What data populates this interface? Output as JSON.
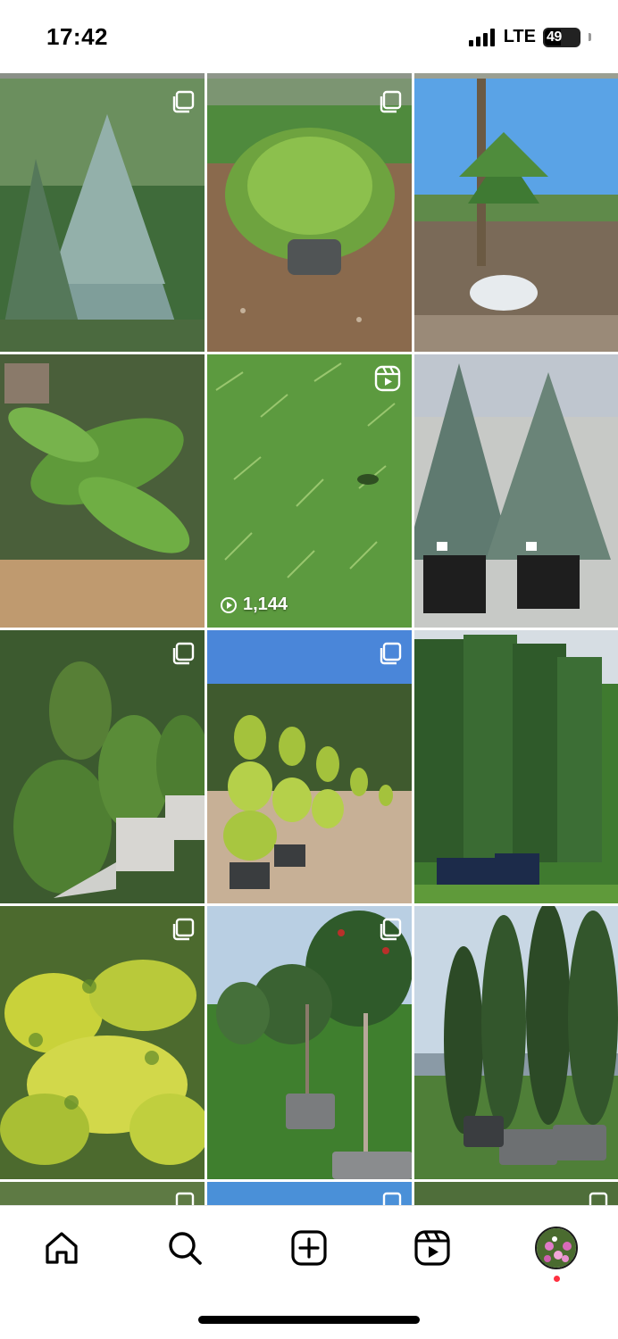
{
  "status_bar": {
    "time": "17:42",
    "network": "LTE",
    "battery": "49"
  },
  "grid": {
    "posts": [
      {
        "type": "multi",
        "subject": "blue spruce"
      },
      {
        "type": "multi",
        "subject": "pittosporum shrub"
      },
      {
        "type": "photo",
        "subject": "yucca"
      },
      {
        "type": "photo",
        "subject": "banana plants"
      },
      {
        "type": "reel",
        "subject": "mondo grass",
        "views": "1,144"
      },
      {
        "type": "photo",
        "subject": "potted fir trees"
      },
      {
        "type": "multi",
        "subject": "boxwood pyramids"
      },
      {
        "type": "multi",
        "subject": "spiral topiary"
      },
      {
        "type": "photo",
        "subject": "tall hedge trees"
      },
      {
        "type": "multi",
        "subject": "golden euonymus"
      },
      {
        "type": "multi",
        "subject": "photinia standards"
      },
      {
        "type": "photo",
        "subject": "columnar trees"
      }
    ]
  },
  "nav": {
    "items": [
      {
        "name": "home",
        "icon": "home-icon"
      },
      {
        "name": "search",
        "icon": "search-icon"
      },
      {
        "name": "create",
        "icon": "plus-square-icon"
      },
      {
        "name": "reels",
        "icon": "reels-icon"
      },
      {
        "name": "profile",
        "icon": "avatar"
      }
    ]
  },
  "colors": {
    "notification_dot": "#ff3040",
    "icon": "#000000"
  }
}
